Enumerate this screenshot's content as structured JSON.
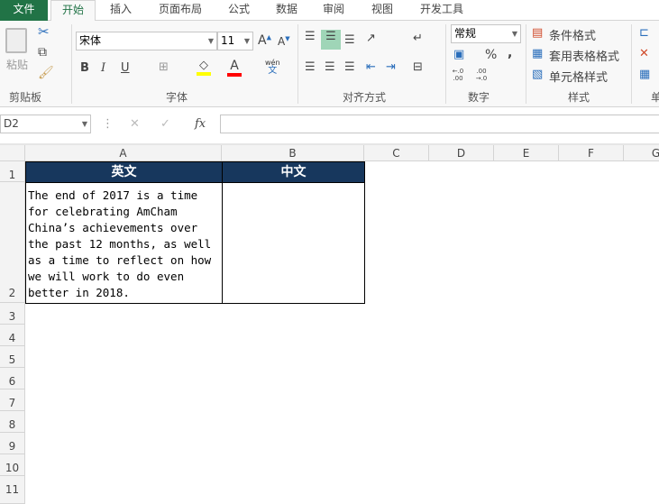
{
  "tabs": [
    "文件",
    "开始",
    "插入",
    "页面布局",
    "公式",
    "数据",
    "审阅",
    "视图",
    "开发工具"
  ],
  "ribbon": {
    "clipboard": {
      "label": "剪贴板",
      "paste": "粘贴"
    },
    "font": {
      "label": "字体",
      "name": "宋体",
      "size": "11",
      "bold": "B",
      "italic": "I",
      "underline": "U",
      "font_color": "A",
      "phonetic_top": "wén",
      "phonetic_bottom": "文",
      "colors": {
        "fill": "#ffff00",
        "font": "#ff0000"
      }
    },
    "alignment": {
      "label": "对齐方式"
    },
    "number": {
      "label": "数字",
      "format": "常规",
      "percent": "%",
      "comma": ",",
      "inc": "←.0 .00",
      "dec": ".00 →.0"
    },
    "styles": {
      "label": "样式",
      "conditional": "条件格式",
      "table": "套用表格格式",
      "cell": "单元格样式"
    },
    "cells": {
      "label": "单"
    }
  },
  "formula_bar": {
    "name_box": "D2",
    "fx": "fx",
    "value": ""
  },
  "columns": [
    "A",
    "B",
    "C",
    "D",
    "E",
    "F",
    "G"
  ],
  "rows": [
    "1",
    "2",
    "3",
    "4",
    "5",
    "6",
    "7",
    "8",
    "9",
    "10",
    "11"
  ],
  "cells": {
    "A1": "英文",
    "B1": "中文",
    "A2": "The end of 2017 is a time for celebrating AmCham China’s achievements over the past 12 months, as well as a time to reflect on how we will work to do even better in 2018.",
    "B2": ""
  }
}
